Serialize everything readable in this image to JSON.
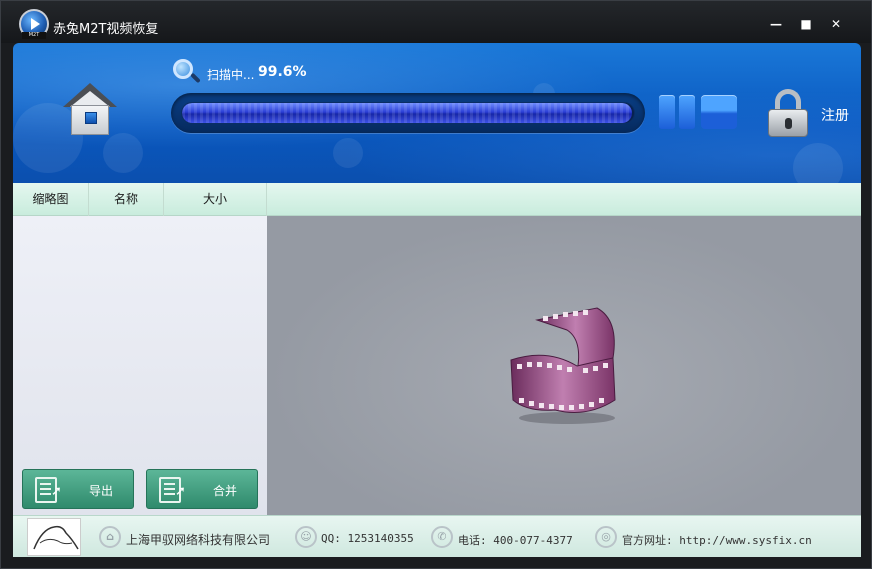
{
  "window": {
    "title": "赤兔M2T视频恢复",
    "logo_tag": "M2T",
    "minimize_label": "—",
    "maximize_label": "■",
    "close_label": "✕"
  },
  "header": {
    "scan_label": "扫描中...",
    "scan_percent": "99.6%",
    "progress_fraction": 0.996,
    "register_label": "注册"
  },
  "columns": [
    "缩略图",
    "名称",
    "大小"
  ],
  "actions": {
    "export_label": "导出",
    "merge_label": "合并"
  },
  "footer": {
    "company": "上海甲驭网络科技有限公司",
    "qq": "QQ: 1253140355",
    "phone": "电话: 400-077-4377",
    "website": "官方网址: http://www.sysfix.cn"
  },
  "colors": {
    "header_blue": "#0a58bf",
    "progress_fill": "#2b3fd6",
    "action_green": "#2f8a6c",
    "film_purple": "#9c4f88"
  }
}
